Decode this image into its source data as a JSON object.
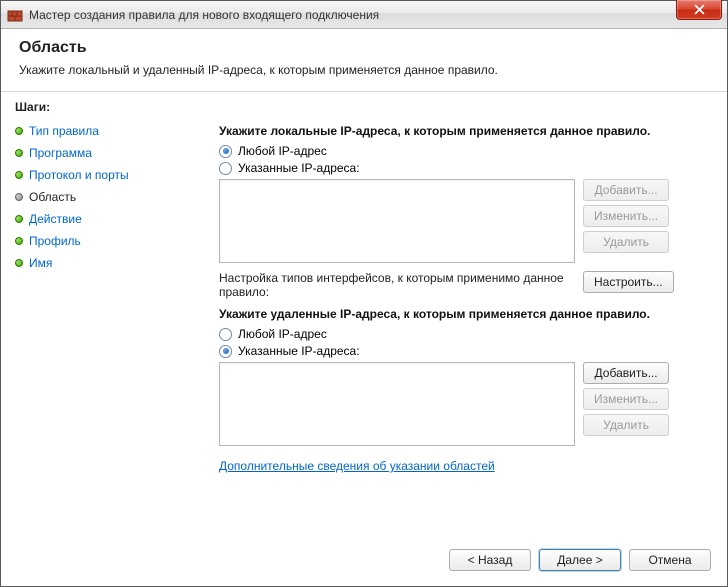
{
  "window": {
    "title": "Мастер создания правила для нового входящего подключения"
  },
  "header": {
    "title": "Область",
    "subtitle": "Укажите локальный и удаленный IP-адреса, к которым применяется данное правило."
  },
  "sidebar": {
    "title": "Шаги:",
    "steps": [
      {
        "label": "Тип правила",
        "current": false
      },
      {
        "label": "Программа",
        "current": false
      },
      {
        "label": "Протокол и порты",
        "current": false
      },
      {
        "label": "Область",
        "current": true
      },
      {
        "label": "Действие",
        "current": false
      },
      {
        "label": "Профиль",
        "current": false
      },
      {
        "label": "Имя",
        "current": false
      }
    ]
  },
  "content": {
    "local": {
      "heading": "Укажите локальные IP-адреса, к которым применяется данное правило.",
      "radio_any": "Любой IP-адрес",
      "radio_specific": "Указанные IP-адреса:",
      "selected": "any",
      "add": "Добавить...",
      "edit": "Изменить...",
      "remove": "Удалить"
    },
    "iface": {
      "text": "Настройка типов интерфейсов, к которым применимо данное правило:",
      "button": "Настроить..."
    },
    "remote": {
      "heading": "Укажите удаленные IP-адреса, к которым применяется данное правило.",
      "radio_any": "Любой IP-адрес",
      "radio_specific": "Указанные IP-адреса:",
      "selected": "specific",
      "add": "Добавить...",
      "edit": "Изменить...",
      "remove": "Удалить"
    },
    "more_link": "Дополнительные сведения об указании областей"
  },
  "footer": {
    "back": "< Назад",
    "next": "Далее >",
    "cancel": "Отмена"
  }
}
